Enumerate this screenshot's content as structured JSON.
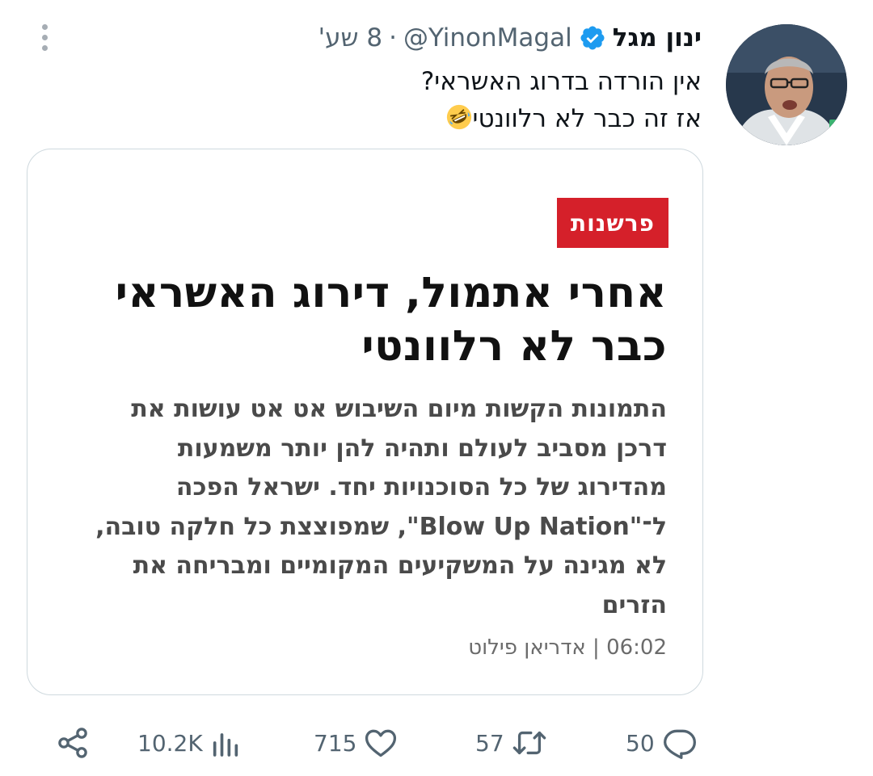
{
  "author": {
    "display_name": "ינון מגל",
    "handle": "@YinonMagal",
    "separator": "·",
    "time": "8 שע'"
  },
  "tweet": {
    "lines": [
      "אין הורדה בדרוג האשראי?",
      "אז זה כבר לא רלוונטי"
    ],
    "emoji": "rolling-on-floor-laughing-emoji"
  },
  "card": {
    "category": "פרשנות",
    "headline_lines": [
      "אחרי אתמול, דירוג האשראי",
      "כבר לא רלוונטי"
    ],
    "summary_lines": [
      "התמונות הקשות מיום השיבוש אט אט עושות את",
      "דרכן מסביב לעולם ותהיה להן יותר משמעות",
      "מהדירוג של כל הסוכנויות יחד. ישראל הפכה",
      "ל־\"Blow Up Nation\", שמפוצצת כל חלקה טובה,",
      "לא מגינה על המשקיעים המקומיים ומבריחה את",
      "הזרים"
    ],
    "meta": "06:02 | אדריאן פילוט",
    "badge_color": "#d5202a"
  },
  "actions": {
    "views": "10.2K",
    "likes": "715",
    "retweets": "57",
    "replies": "50"
  },
  "colors": {
    "verified": "#1d9bf0",
    "secondary_text": "#536471",
    "border": "#cfd9de"
  }
}
